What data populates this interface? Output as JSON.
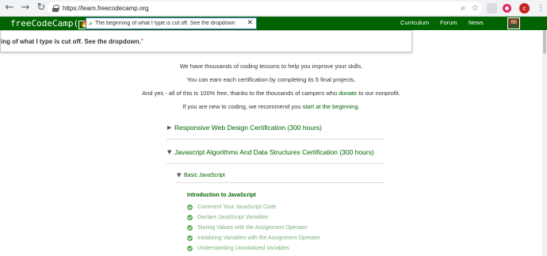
{
  "browser": {
    "url": "https://learn.freecodecamp.org",
    "profile_initial": "c"
  },
  "nav": {
    "logo_text": "freeCodeCamp(",
    "logo_flame": "🔥",
    "logo_close": ")",
    "search_value": "The beginning of what I type is cut off. See the dropdown",
    "links": [
      "Curriculum",
      "Forum",
      "News"
    ]
  },
  "dropdown": {
    "hit_text": "ing of what I type is cut off. See the dropdown.",
    "hit_mark": "\""
  },
  "intro": {
    "line1": "We have thousands of coding lessons to help you improve your skills.",
    "line2": "You can earn each certification by completing its 5 final projects.",
    "line3_pre": "And yes - all of this is 100% free, thanks to the thousands of campers who ",
    "line3_link": "donate",
    "line3_post": " to our nonprofit.",
    "line4_pre": "If you are new to coding, we recommend you ",
    "line4_link": "start at the beginning",
    "line4_post": "."
  },
  "certs": [
    {
      "label": "Responsive Web Design Certification (300 hours)",
      "expanded": false
    },
    {
      "label": "Javascript Algorithms And Data Structures Certification (300 hours)",
      "expanded": true
    }
  ],
  "block": {
    "label": "Basic JavaScript",
    "section": "Introduction to JavaScript",
    "lessons": [
      "Comment Your JavaScript Code",
      "Declare JavaScript Variables",
      "Storing Values with the Assignment Operator",
      "Initializing Variables with the Assignment Operator",
      "Understanding Uninitialized Variables"
    ]
  },
  "colors": {
    "brand_green": "#006400",
    "check_green": "#5aab5a"
  }
}
